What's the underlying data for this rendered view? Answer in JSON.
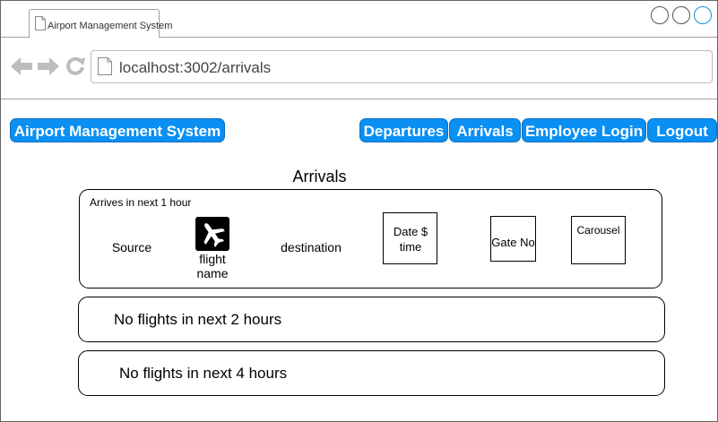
{
  "browser": {
    "tab_title": "Airport Management System",
    "url": "localhost:3002/arrivals",
    "icons": [
      "page-icon",
      "back-arrow-icon",
      "forward-arrow-icon",
      "reload-icon"
    ]
  },
  "header": {
    "brand_label": "Airport Management System",
    "nav": {
      "departures": "Departures",
      "arrivals": "Arrivals",
      "employee_login": "Employee Login",
      "logout": "Logout"
    },
    "accent_color": "#0a8ff2"
  },
  "main": {
    "title": "Arrivals",
    "next_hour_card": {
      "heading": "Arrives in next 1 hour",
      "source_label": "Source",
      "flight_name_label": "flight name",
      "destination_label": "destination",
      "date_time_label": "Date $ time",
      "gate_label": "Gate No",
      "carousel_label": "Carousel",
      "icon": "airplane-icon"
    },
    "next_2_hours_text": "No flights in next 2 hours",
    "next_4_hours_text": "No flights in next 4 hours"
  }
}
